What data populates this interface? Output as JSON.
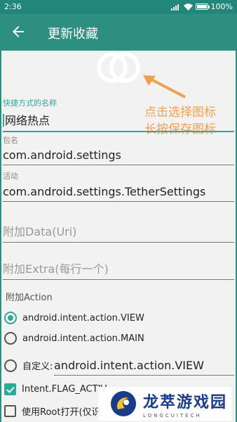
{
  "status_bar": {
    "time": "2:36",
    "battery": "100%",
    "battery_level": 1.0
  },
  "app_bar": {
    "title": "更新收藏"
  },
  "hint": {
    "line1": "点击选择图标",
    "line2": "长按保存图标",
    "color": "#f0a050"
  },
  "form": {
    "shortcut_name": {
      "label": "快捷方式的名称",
      "value": "网络热点"
    },
    "package": {
      "label": "包名",
      "value": "com.android.settings"
    },
    "activity": {
      "label": "活动",
      "value": "com.android.settings.TetherSettings"
    },
    "data_uri": {
      "placeholder": "附加Data(Uri)"
    },
    "extra": {
      "placeholder": "附加Extra(每行一个)"
    },
    "action": {
      "label": "附加Action",
      "options": [
        {
          "text": "android.intent.action.VIEW",
          "selected": true
        },
        {
          "text": "android.intent.action.MAIN",
          "selected": false
        }
      ],
      "custom_label": "自定义:",
      "custom_value": "android.intent.action.VIEW"
    },
    "flags": [
      {
        "text": "Intent.FLAG_ACTIV",
        "checked": true
      },
      {
        "text": "使用Root打开(仅识",
        "checked": false
      }
    ]
  },
  "watermark": {
    "title": "龙萃游戏园",
    "subtitle": "LONGCUITECH"
  },
  "colors": {
    "primary": "#2c8f80",
    "accent": "#2ea898",
    "status": "#23867a"
  }
}
